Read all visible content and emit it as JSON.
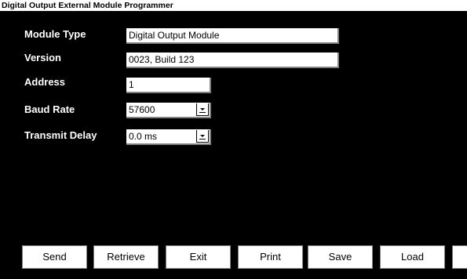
{
  "window": {
    "title": "Digital Output External Module Programmer"
  },
  "form": {
    "module_type": {
      "label": "Module Type",
      "value": "Digital Output Module"
    },
    "version": {
      "label": "Version",
      "value": "0023, Build 123"
    },
    "address": {
      "label": "Address",
      "value": "1"
    },
    "baud_rate": {
      "label": "Baud Rate",
      "value": "57600"
    },
    "transmit_delay": {
      "label": "Transmit Delay",
      "value": "0.0 ms"
    }
  },
  "buttons": {
    "send": "Send",
    "retrieve": "Retrieve",
    "exit": "Exit",
    "print": "Print",
    "save": "Save",
    "load": "Load"
  },
  "icons": {
    "dropdown": "chevron-down-icon"
  }
}
